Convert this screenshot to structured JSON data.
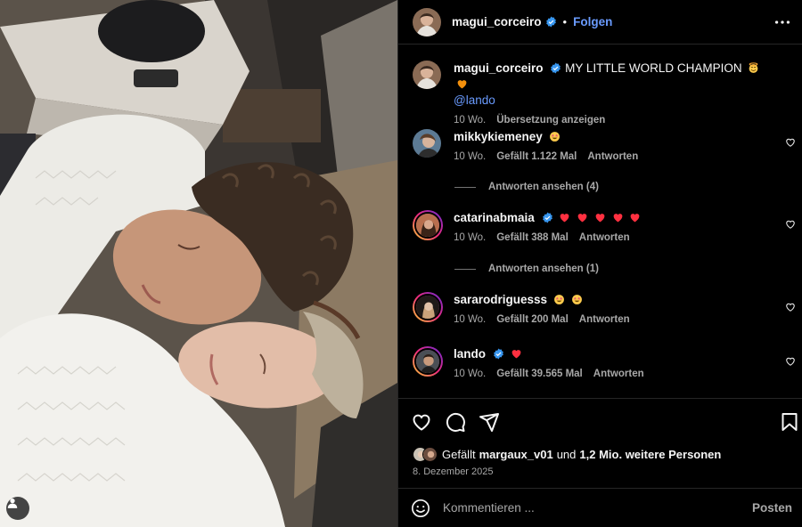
{
  "post": {
    "author": "magui_corceiro",
    "follow_label": "Folgen",
    "separator": "•",
    "caption_text": "MY LITTLE WORLD CHAMPION",
    "caption_mention": "@lando",
    "caption_time": "10 Wo.",
    "translate_label": "Übersetzung anzeigen"
  },
  "comments": [
    {
      "user": "mikkykiemeney",
      "verified": false,
      "emojis": [
        "star-struck"
      ],
      "time": "10 Wo.",
      "likes": "Gefällt 1.122 Mal",
      "reply": "Antworten",
      "replies": "Antworten ansehen (4)"
    },
    {
      "user": "catarinabmaia",
      "verified": true,
      "emojis": [
        "heart",
        "heart",
        "heart",
        "heart",
        "heart"
      ],
      "time": "10 Wo.",
      "likes": "Gefällt 388 Mal",
      "reply": "Antworten",
      "replies": "Antworten ansehen (1)"
    },
    {
      "user": "sararodriguesss",
      "verified": false,
      "emojis": [
        "star-struck",
        "star-struck"
      ],
      "time": "10 Wo.",
      "likes": "Gefällt 200 Mal",
      "reply": "Antworten"
    },
    {
      "user": "lando",
      "verified": true,
      "emojis": [
        "heart"
      ],
      "time": "10 Wo.",
      "likes": "Gefällt 39.565 Mal",
      "reply": "Antworten"
    }
  ],
  "footer": {
    "likes_prefix": "Gefällt",
    "likes_user": "margaux_v01",
    "likes_mid": "und",
    "likes_rest": "1,2 Mio. weitere Personen",
    "date": "8. Dezember 2025"
  },
  "composer": {
    "placeholder": "Kommentieren ...",
    "post_label": "Posten"
  },
  "colors": {
    "accent": "#6a9bff",
    "verified": "#3897f0",
    "heart": "#ff3040"
  }
}
